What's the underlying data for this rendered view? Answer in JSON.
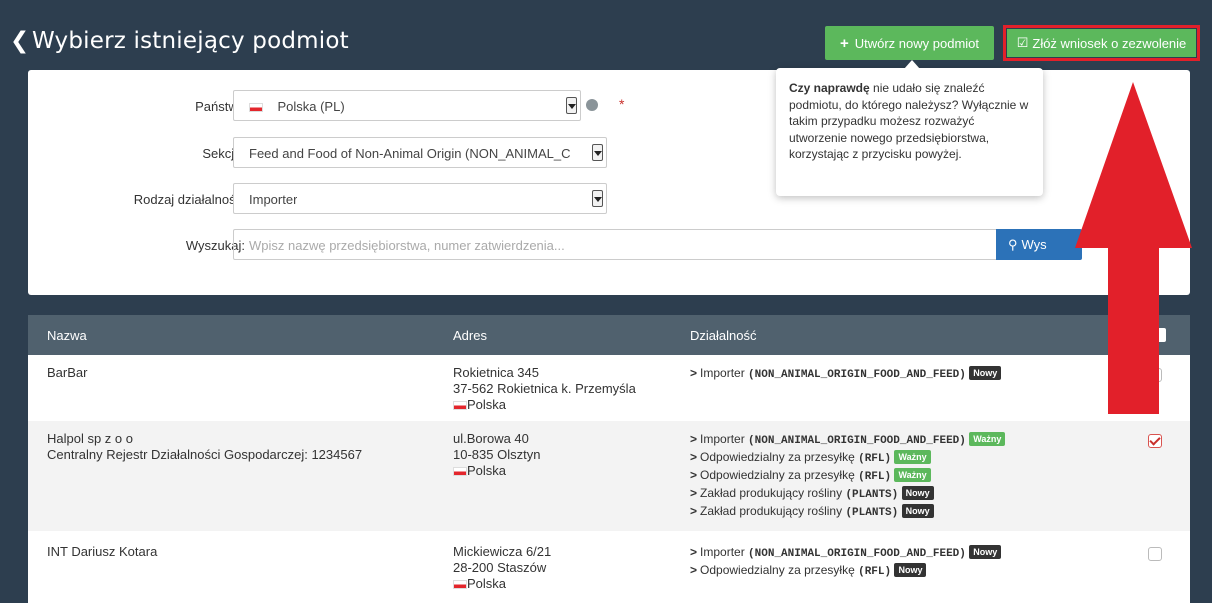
{
  "header": {
    "back_icon": "chevron-left-icon",
    "title": "Wybierz istniejący podmiot",
    "create_button": "Utwórz nowy podmiot",
    "apply_button": "Złóż wniosek o zezwolenie"
  },
  "tooltip": {
    "bold": "Czy naprawdę",
    "text": " nie udało się znaleźć podmiotu, do którego należysz? Wyłącznie w takim przypadku możesz rozważyć utworzenie nowego przedsiębiorstwa, korzystając z przycisku powyżej."
  },
  "form": {
    "country_label": "Państwo",
    "country_value": "Polska (PL)",
    "required_mark": "*",
    "section_label": "Sekcja:",
    "section_value": "Feed and Food of Non-Animal Origin (NON_ANIMAL_C",
    "activity_label": "Rodzaj działalności",
    "activity_value": "Importer",
    "search_label": "Wyszukaj:",
    "search_placeholder": "Wpisz nazwę przedsiębiorstwa, numer zatwierdzenia...",
    "search_button": "Wys"
  },
  "table": {
    "headers": {
      "name": "Nazwa",
      "address": "Adres",
      "activity": "Działalność"
    },
    "rows": [
      {
        "name": "BarBar",
        "name2": "",
        "addr1": "Rokietnica 345",
        "addr2": "37-562 Rokietnica k. Przemyśla",
        "country": "Polska",
        "activities": [
          {
            "label": "Importer",
            "code": "(NON_ANIMAL_ORIGIN_FOOD_AND_FEED)",
            "badge": "Nowy"
          }
        ]
      },
      {
        "name": "Halpol sp z o o",
        "name2": "Centralny Rejestr Działalności Gospodarczej: 1234567",
        "addr1": "ul.Borowa 40",
        "addr2": "10-835 Olsztyn",
        "country": "Polska",
        "activities": [
          {
            "label": "Importer",
            "code": "(NON_ANIMAL_ORIGIN_FOOD_AND_FEED)",
            "badge": "Ważny"
          },
          {
            "label": "Odpowiedzialny za przesyłkę",
            "code": "(RFL)",
            "badge": "Ważny"
          },
          {
            "label": "Odpowiedzialny za przesyłkę",
            "code": "(RFL)",
            "badge": "Ważny"
          },
          {
            "label": "Zakład produkujący rośliny",
            "code": "(PLANTS)",
            "badge": "Nowy"
          },
          {
            "label": "Zakład produkujący rośliny",
            "code": "(PLANTS)",
            "badge": "Nowy"
          }
        ]
      },
      {
        "name": "INT Dariusz Kotara",
        "name2": "",
        "addr1": "Mickiewicza 6/21",
        "addr2": "28-200 Staszów",
        "country": "Polska",
        "activities": [
          {
            "label": "Importer",
            "code": "(NON_ANIMAL_ORIGIN_FOOD_AND_FEED)",
            "badge": "Nowy"
          },
          {
            "label": "Odpowiedzialny za przesyłkę",
            "code": "(RFL)",
            "badge": "Nowy"
          }
        ]
      }
    ]
  },
  "colors": {
    "header_bg": "#2d3e4f",
    "success": "#5cb85c",
    "primary": "#2c72b8",
    "annotation_red": "#e2202a"
  }
}
